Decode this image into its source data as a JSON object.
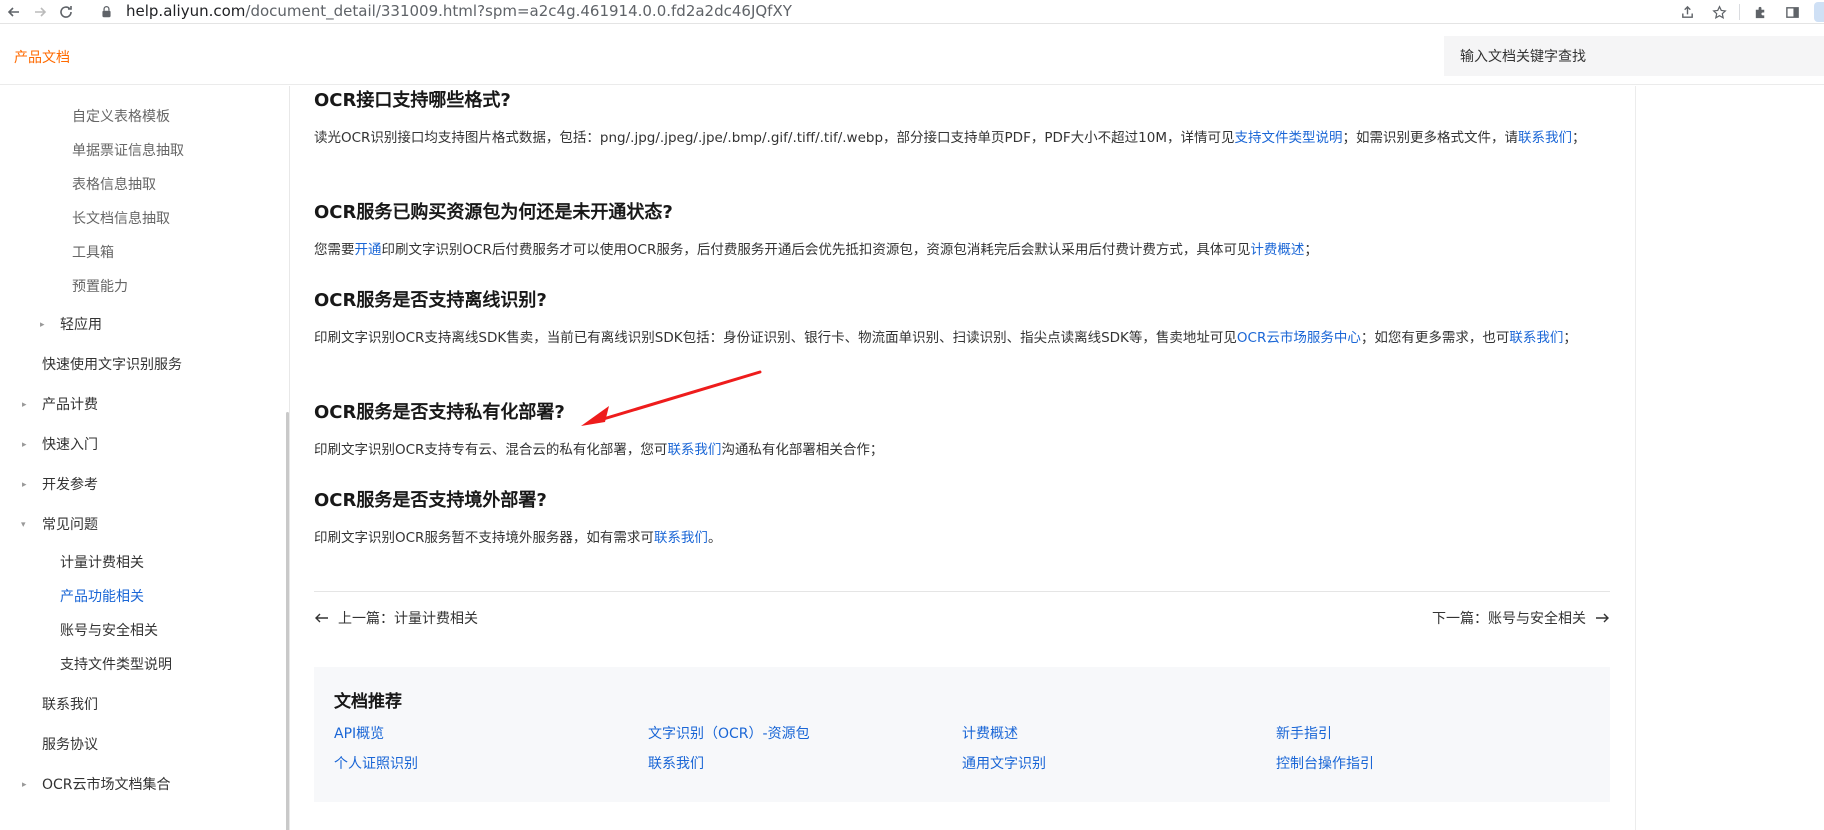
{
  "browser": {
    "url_host": "help.aliyun.com",
    "url_rest": "/document_detail/331009.html?spm=a2c4g.461914.0.0.fd2a2dc46JQfXY"
  },
  "header": {
    "brand": "产品文档",
    "search_placeholder": "输入文档关键字查找"
  },
  "sidebar": {
    "items": [
      {
        "label": "自定义表格模板"
      },
      {
        "label": "单据票证信息抽取"
      },
      {
        "label": "表格信息抽取"
      },
      {
        "label": "长文档信息抽取"
      },
      {
        "label": "工具箱"
      },
      {
        "label": "预置能力"
      },
      {
        "label": "轻应用"
      },
      {
        "label": "快速使用文字识别服务"
      },
      {
        "label": "产品计费"
      },
      {
        "label": "快速入门"
      },
      {
        "label": "开发参考"
      },
      {
        "label": "常见问题"
      },
      {
        "label": "计量计费相关"
      },
      {
        "label": "产品功能相关"
      },
      {
        "label": "账号与安全相关"
      },
      {
        "label": "支持文件类型说明"
      },
      {
        "label": "联系我们"
      },
      {
        "label": "服务协议"
      },
      {
        "label": "OCR云市场文档集合"
      }
    ]
  },
  "main": {
    "sections": [
      {
        "title": "OCR接口支持哪些格式?",
        "p1": "读光OCR识别接口均支持图片格式数据，包括：png/.jpg/.jpeg/.jpe/.bmp/.gif/.tiff/.tif/.webp，部分接口支持单页PDF，PDF大小不超过10M，详情可见",
        "link1": "支持文件类型说明",
        "p2": "；如需识别更多格式文件，请",
        "link2": "联系我们",
        "p3": "；"
      },
      {
        "title": "OCR服务已购买资源包为何还是未开通状态?",
        "p1": "您需要",
        "link1": "开通",
        "p2": "印刷文字识别OCR后付费服务才可以使用OCR服务，后付费服务开通后会优先抵扣资源包，资源包消耗完后会默认采用后付费计费方式，具体可见",
        "link2": "计费概述",
        "p3": "；"
      },
      {
        "title": "OCR服务是否支持离线识别?",
        "p1": "印刷文字识别OCR支持离线SDK售卖，当前已有离线识别SDK包括：身份证识别、银行卡、物流面单识别、扫读识别、指尖点读离线SDK等，售卖地址可见",
        "link1": "OCR云市场服务中心",
        "p2": "；如您有更多需求，也可",
        "link2": "联系我们",
        "p3": "；"
      },
      {
        "title": "OCR服务是否支持私有化部署?",
        "p1": "印刷文字识别OCR支持专有云、混合云的私有化部署，您可",
        "link1": "联系我们",
        "p2": "沟通私有化部署相关合作；"
      },
      {
        "title": "OCR服务是否支持境外部署?",
        "p1": "印刷文字识别OCR服务暂不支持境外服务器，如有需求可",
        "link1": "联系我们",
        "p2": "。"
      }
    ],
    "prev_label": "上一篇：计量计费相关",
    "next_label": "下一篇：账号与安全相关",
    "recommend": {
      "title": "文档推荐",
      "links": [
        "API概览",
        "文字识别（OCR）-资源包",
        "计费概述",
        "新手指引",
        "个人证照识别",
        "联系我们",
        "通用文字识别",
        "控制台操作指引"
      ]
    }
  },
  "colors": {
    "brand": "#ff6a00",
    "link": "#1a66d6",
    "annotation_arrow": "#ee1c1c"
  }
}
